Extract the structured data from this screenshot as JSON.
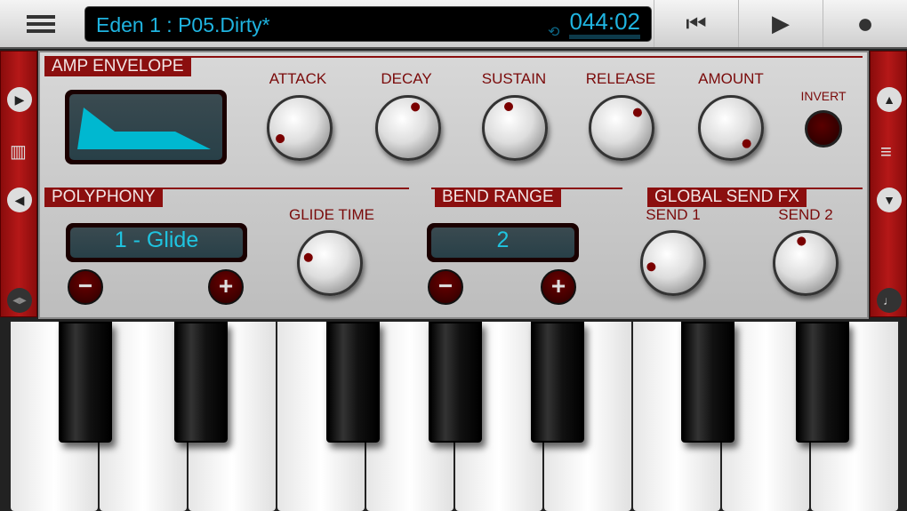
{
  "header": {
    "preset": "Eden 1 : P05.Dirty*",
    "time": "044:02",
    "prev": "⏮",
    "play": "▶",
    "record": "●"
  },
  "sections": {
    "amp_envelope": "AMP ENVELOPE",
    "polyphony": "POLYPHONY",
    "bend_range": "BEND RANGE",
    "global_send_fx": "GLOBAL SEND FX"
  },
  "knobs": [
    {
      "id": "attack",
      "label": "ATTACK",
      "value": 0.06
    },
    {
      "id": "decay",
      "label": "DECAY",
      "value": 0.57
    },
    {
      "id": "sustain",
      "label": "SUSTAIN",
      "value": 0.44
    },
    {
      "id": "release",
      "label": "RELEASE",
      "value": 0.67
    },
    {
      "id": "amount",
      "label": "AMOUNT",
      "value": 1.0
    },
    {
      "id": "glide-time",
      "label": "GLIDE TIME",
      "value": 0.22
    },
    {
      "id": "send-1",
      "label": "SEND 1",
      "value": 0.13
    },
    {
      "id": "send-2",
      "label": "SEND 2",
      "value": 0.46
    }
  ],
  "invert_label": "INVERT",
  "polyphony_value": "1 - Glide",
  "bend_range_value": "2",
  "minus": "−",
  "plus": "+",
  "colors": {
    "accent": "#8b0f0f",
    "lcd": "#1fc4e0"
  }
}
